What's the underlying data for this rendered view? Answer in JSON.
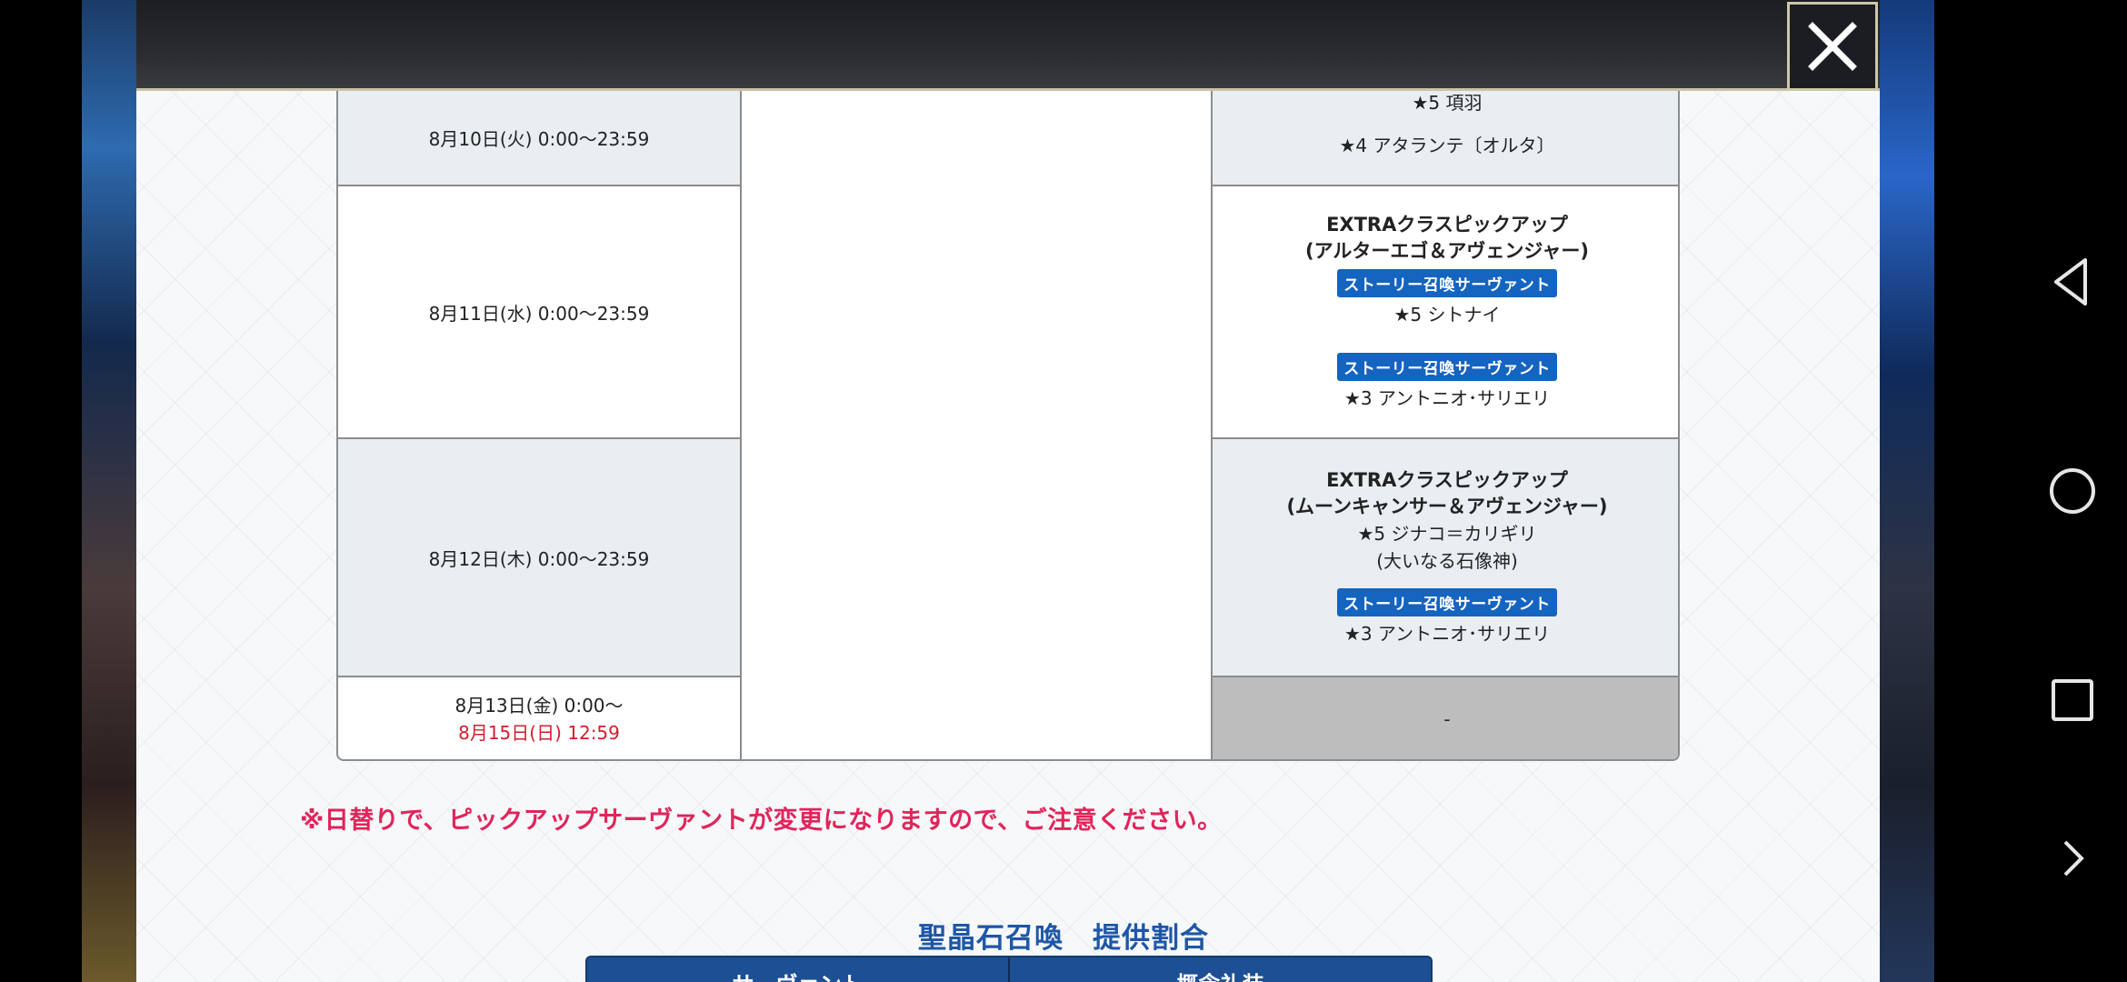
{
  "header": {
    "close_icon": "close-icon"
  },
  "schedule": {
    "rows": [
      {
        "date": "8月10日(火) 0:00～23:59",
        "pickup_lines": [
          "★5 項羽",
          "★4 アタランテ〔オルタ〕"
        ]
      },
      {
        "date": "8月11日(水) 0:00～23:59",
        "title_line1": "EXTRAクラスピックアップ",
        "title_line2": "(アルターエゴ＆アヴェンジャー)",
        "badge1": "ストーリー召喚サーヴァント",
        "servant1": "★5 シトナイ",
        "badge2": "ストーリー召喚サーヴァント",
        "servant2": "★3 アントニオ･サリエリ"
      },
      {
        "date": "8月12日(木) 0:00～23:59",
        "title_line1": "EXTRAクラスピックアップ",
        "title_line2": "(ムーンキャンサー＆アヴェンジャー)",
        "servant1_line1": "★5 ジナコ＝カリギリ",
        "servant1_line2": "(大いなる石像神)",
        "badge": "ストーリー召喚サーヴァント",
        "servant2": "★3 アントニオ･サリエリ"
      },
      {
        "date_line1": "8月13日(金) 0:00～",
        "date_line2": "8月15日(日) 12:59",
        "pickup": "-"
      }
    ]
  },
  "notice": "※日替りで、ピックアップサーヴァントが変更になりますので、ご注意ください。",
  "section_title": "聖晶石召喚　提供割合",
  "rate_table": {
    "col1": "サーヴァント",
    "col2": "概念礼装"
  },
  "navbar": {
    "back": "back-icon",
    "home": "home-icon",
    "recents": "recents-icon",
    "more": "chevron-right-icon"
  }
}
